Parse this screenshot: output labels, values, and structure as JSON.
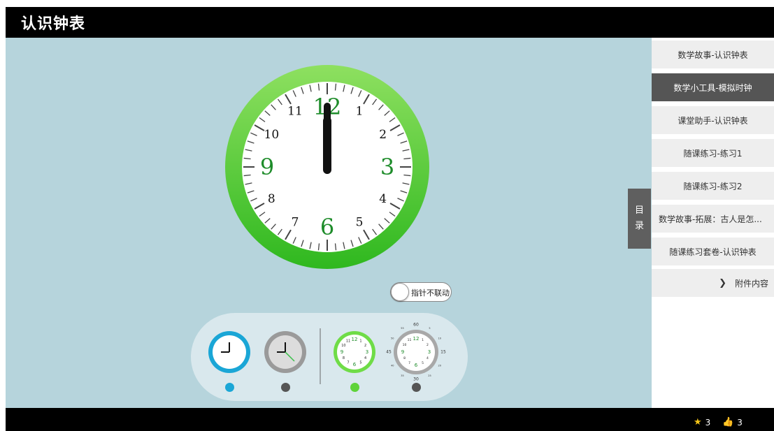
{
  "app": {
    "title": "认识钟表"
  },
  "clock": {
    "numbers": [
      "12",
      "1",
      "2",
      "3",
      "4",
      "5",
      "6",
      "7",
      "8",
      "9",
      "10",
      "11"
    ],
    "time": {
      "hour": 12,
      "minute": 0
    },
    "colors": {
      "rim": "#5fd33a",
      "rim_dark": "#2fae1f",
      "major_numbers": "#1e8c2a",
      "minor_numbers": "#111111",
      "hands": "#111111"
    }
  },
  "toggle": {
    "label": "指针不联动",
    "on": false
  },
  "tools": {
    "items": [
      {
        "name": "blue-clock",
        "dot_color": "#1aa6d6"
      },
      {
        "name": "gray-clock",
        "dot_color": "#555555"
      },
      {
        "name": "green-clock",
        "dot_color": "#5fd33a"
      },
      {
        "name": "minutes-clock",
        "dot_color": "#555555"
      }
    ],
    "green_clock_numbers": [
      "12",
      "1",
      "2",
      "3",
      "4",
      "5",
      "6",
      "7",
      "8",
      "9",
      "10",
      "11"
    ],
    "minutes_outer_labels": [
      "60",
      "5",
      "10",
      "15",
      "20",
      "25",
      "30",
      "35",
      "40",
      "45",
      "50",
      "55"
    ]
  },
  "sidebar": {
    "toc_label_top": "目",
    "toc_label_bottom": "录",
    "items": [
      {
        "label": "数学故事-认识钟表",
        "active": false
      },
      {
        "label": "数学小工具-模拟时钟",
        "active": true
      },
      {
        "label": "课堂助手-认识钟表",
        "active": false
      },
      {
        "label": "随课练习-练习1",
        "active": false
      },
      {
        "label": "随课练习-练习2",
        "active": false
      },
      {
        "label": "数学故事-拓展：古人是怎...",
        "active": false
      },
      {
        "label": "随课练习套卷-认识钟表",
        "active": false
      }
    ],
    "attachments": {
      "label": "附件内容"
    }
  },
  "stats": {
    "stars": "3",
    "likes": "3"
  }
}
